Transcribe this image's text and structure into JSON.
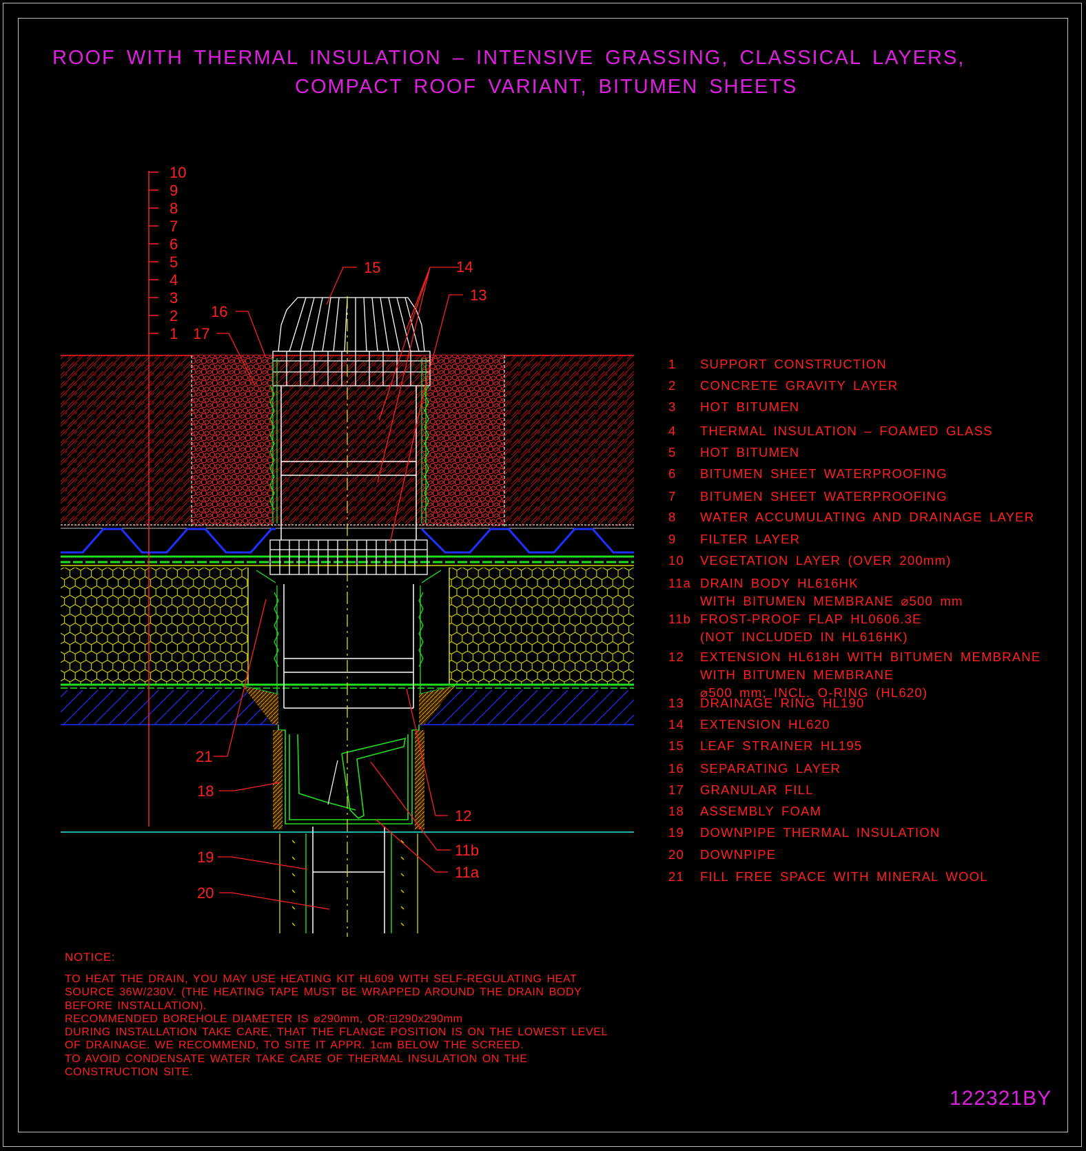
{
  "title": {
    "line1": "ROOF WITH THERMAL INSULATION – INTENSIVE GRASSING, CLASSICAL LAYERS,",
    "line2": "COMPACT ROOF VARIANT, BITUMEN SHEETS"
  },
  "scale_labels": [
    "10",
    "9",
    "8",
    "7",
    "6",
    "5",
    "4",
    "3",
    "2",
    "1"
  ],
  "callouts": {
    "c15": "15",
    "c14": "14",
    "c13": "13",
    "c16": "16",
    "c17": "17",
    "c21": "21",
    "c18": "18",
    "c12": "12",
    "c11b": "11b",
    "c11a": "11a",
    "c19": "19",
    "c20": "20"
  },
  "legend": [
    {
      "num": "1",
      "lines": [
        "SUPPORT CONSTRUCTION"
      ]
    },
    {
      "num": "2",
      "lines": [
        "CONCRETE GRAVITY LAYER"
      ]
    },
    {
      "num": "3",
      "lines": [
        "HOT BITUMEN"
      ]
    },
    {
      "num": "4",
      "lines": [
        "THERMAL INSULATION – FOAMED GLASS"
      ]
    },
    {
      "num": "5",
      "lines": [
        "HOT BITUMEN"
      ]
    },
    {
      "num": "6",
      "lines": [
        "BITUMEN SHEET WATERPROOFING"
      ]
    },
    {
      "num": "7",
      "lines": [
        "BITUMEN SHEET WATERPROOFING"
      ]
    },
    {
      "num": "8",
      "lines": [
        "WATER ACCUMULATING AND DRAINAGE LAYER"
      ]
    },
    {
      "num": "9",
      "lines": [
        "FILTER LAYER"
      ]
    },
    {
      "num": "10",
      "lines": [
        "VEGETATION LAYER (OVER 200mm)"
      ]
    },
    {
      "num": "11a",
      "lines": [
        "DRAIN BODY HL616HK",
        "WITH BITUMEN MEMBRANE ⌀500 mm"
      ]
    },
    {
      "num": "11b",
      "lines": [
        "FROST-PROOF FLAP HL0606.3E",
        "(NOT INCLUDED IN HL616HK)"
      ]
    },
    {
      "num": "12",
      "lines": [
        "EXTENSION HL618H WITH BITUMEN MEMBRANE",
        "WITH BITUMEN MEMBRANE",
        "⌀500 mm; INCL. O-RING (HL620)"
      ]
    },
    {
      "num": "13",
      "lines": [
        "DRAINAGE RING HL190"
      ]
    },
    {
      "num": "14",
      "lines": [
        "EXTENSION HL620"
      ]
    },
    {
      "num": "15",
      "lines": [
        "LEAF STRAINER HL195"
      ]
    },
    {
      "num": "16",
      "lines": [
        "SEPARATING LAYER"
      ]
    },
    {
      "num": "17",
      "lines": [
        "GRANULAR FILL"
      ]
    },
    {
      "num": "18",
      "lines": [
        "ASSEMBLY FOAM"
      ]
    },
    {
      "num": "19",
      "lines": [
        "DOWNPIPE THERMAL INSULATION"
      ]
    },
    {
      "num": "20",
      "lines": [
        "DOWNPIPE"
      ]
    },
    {
      "num": "21",
      "lines": [
        "FILL FREE SPACE WITH MINERAL WOOL"
      ]
    }
  ],
  "notice": {
    "title": "NOTICE:",
    "lines": [
      "TO HEAT THE DRAIN, YOU MAY USE HEATING KIT HL609 WITH SELF-REGULATING HEAT",
      "SOURCE 36W/230V. (THE HEATING TAPE MUST BE WRAPPED AROUND THE DRAIN BODY",
      "BEFORE INSTALLATION).",
      "RECOMMENDED BOREHOLE DIAMETER IS ⌀290mm, OR:⊡290x290mm",
      "DURING INSTALLATION TAKE CARE, THAT THE FLANGE POSITION IS ON THE LOWEST LEVEL",
      "OF DRAINAGE. WE RECOMMEND, TO SITE IT APPR. 1cm BELOW THE SCREED.",
      "TO AVOID CONDENSATE WATER TAKE CARE OF THERMAL INSULATION ON THE",
      "CONSTRUCTION SITE."
    ]
  },
  "drawing_code": "122321BY",
  "colors": {
    "background": "#000000",
    "title": "#e020e0",
    "text": "#ff2020",
    "drain": "#ffffff",
    "insulation": "#d8d800",
    "drainage_layer": "#2030ff",
    "waterproofing": "#20e020",
    "support": "#20b0b0",
    "axis": "#e0e000"
  }
}
